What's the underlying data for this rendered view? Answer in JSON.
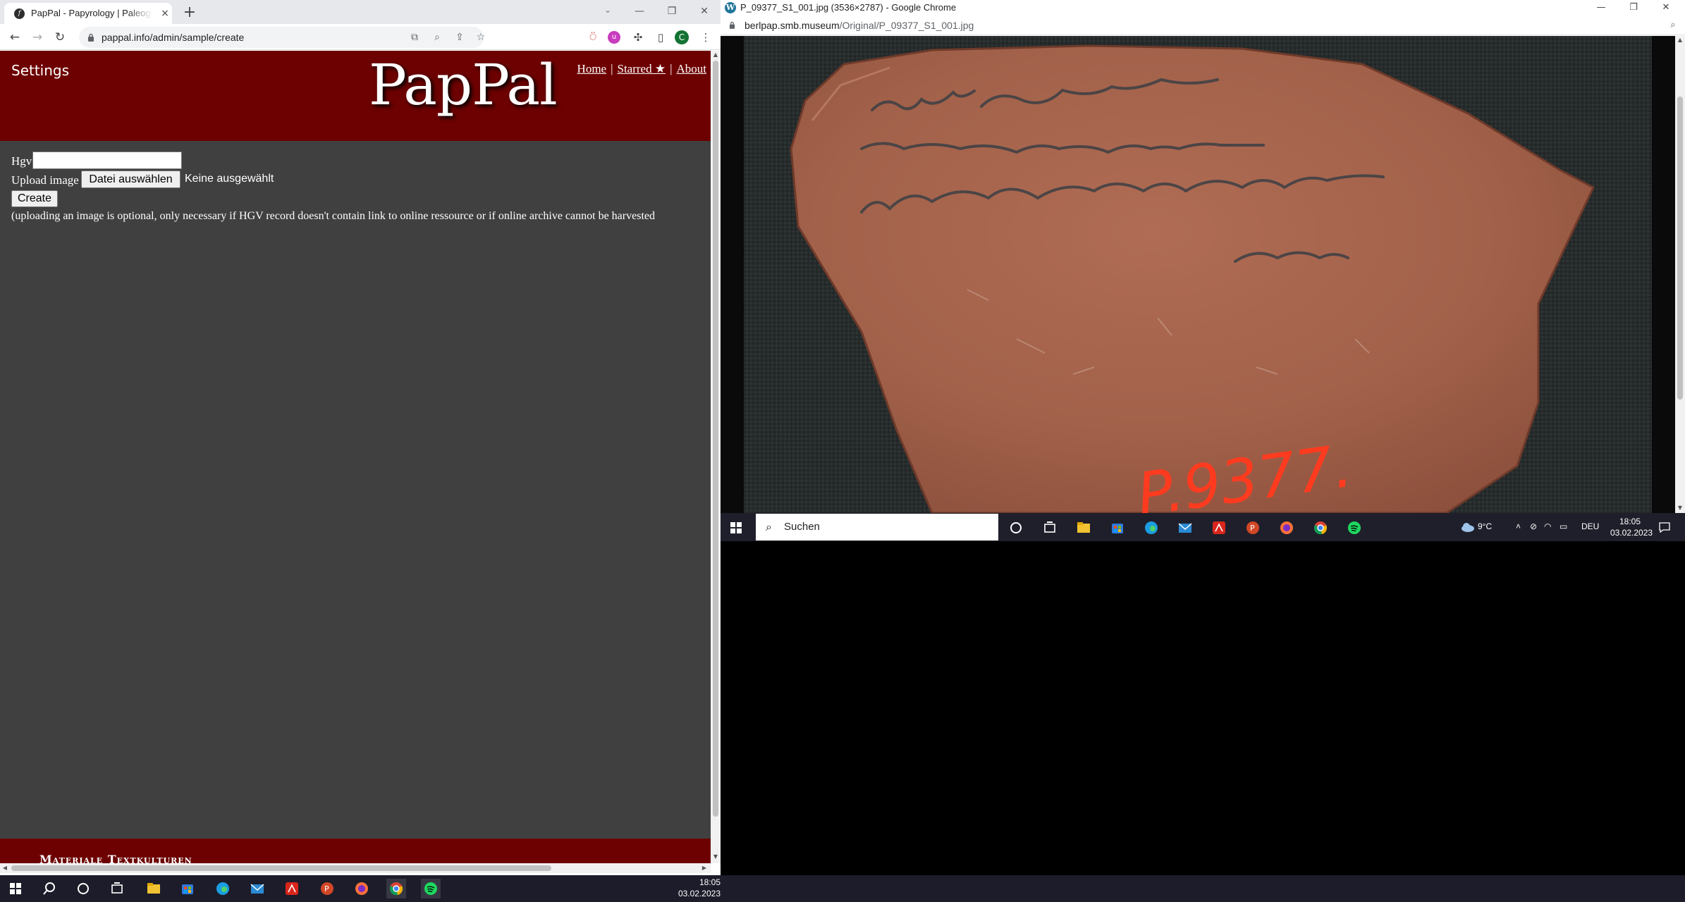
{
  "left_window": {
    "tab": {
      "title": "PapPal - Papyrology | Paleography",
      "close_label": "×"
    },
    "new_tab_label": "+",
    "address_url": "pappal.info/admin/sample/create",
    "profile_initial": "C",
    "page": {
      "settings_label": "Settings",
      "logo_text": "PapPal",
      "nav": {
        "home": "Home",
        "starred": "Starred ★",
        "about": "About",
        "separator": "|"
      },
      "form": {
        "hgv_label": "Hgv",
        "hgv_value": "",
        "upload_label": "Upload image",
        "file_button_label": "Datei auswählen",
        "file_status": "Keine ausgewählt",
        "create_button_label": "Create",
        "hint_text": "(uploading an image is optional, only necessary if HGV record doesn't contain link to online ressource or if online archive cannot be harvested"
      },
      "footer_text": "Materiale Textkulturen"
    }
  },
  "right_window": {
    "title": "P_09377_S1_001.jpg (3536×2787) - Google Chrome",
    "url_host": "berlpap.smb.museum",
    "url_path": "/Original/P_09377_S1_001.jpg",
    "image": {
      "label": "P.9377.",
      "subject": "ostracon"
    },
    "taskbar": {
      "search_placeholder": "Suchen",
      "weather": "9°C",
      "language": "DEU",
      "time": "18:05",
      "date": "03.02.2023"
    }
  },
  "taskbar": {
    "time": "18:05",
    "date": "03.02.2023"
  },
  "colors": {
    "banner": "#6d0000",
    "page_bg": "#404040",
    "taskbar": "#1c1c2a",
    "ostracon": "#a4614a",
    "label_red": "#ff3b1f"
  }
}
